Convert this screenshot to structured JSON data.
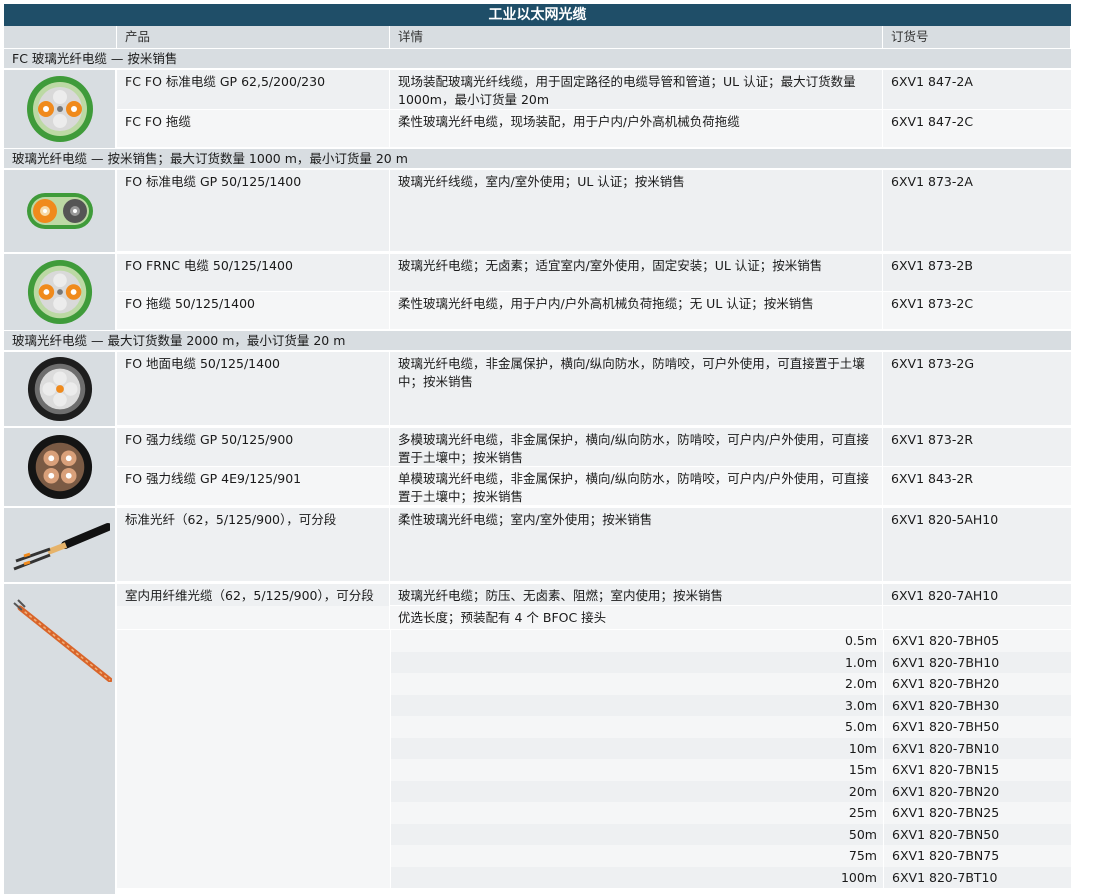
{
  "title": "工业以太网光缆",
  "headers": {
    "product": "产品",
    "details": "详情",
    "order": "订货号"
  },
  "sections": [
    {
      "label": "FC 玻璃光纤电缆 — 按米销售"
    },
    {
      "label": "玻璃光纤电缆 — 按米销售；最大订货数量 1000 m，最小订货量 20 m"
    },
    {
      "label": "玻璃光纤电缆 — 最大订货数量 2000 m，最小订货量 20 m"
    }
  ],
  "rows": [
    {
      "product": "FC FO 标准电缆 GP 62,5/200/230",
      "details": "现场装配玻璃光纤线缆，用于固定路径的电缆导管和管道；UL 认证；最大订货数量 1000m，最小订货量 20m",
      "order": "6XV1 847-2A"
    },
    {
      "product": "FC FO 拖缆",
      "details": "柔性玻璃光纤电缆，现场装配，用于户内/户外高机械负荷拖缆",
      "order": "6XV1 847-2C"
    },
    {
      "product": "FO 标准电缆 GP 50/125/1400",
      "details": "玻璃光纤线缆，室内/室外使用；UL 认证；按米销售",
      "order": "6XV1 873-2A"
    },
    {
      "product": "FO FRNC 电缆 50/125/1400",
      "details": "玻璃光纤电缆；无卤素；适宜室内/室外使用，固定安装；UL 认证；按米销售",
      "order": "6XV1 873-2B"
    },
    {
      "product": "FO 拖缆 50/125/1400",
      "details": "柔性玻璃光纤电缆，用于户内/户外高机械负荷拖缆；无 UL 认证；按米销售",
      "order": "6XV1 873-2C"
    },
    {
      "product": "FO 地面电缆 50/125/1400",
      "details": "玻璃光纤电缆，非金属保护，横向/纵向防水，防啃咬，可户外使用，可直接置于土壤中；按米销售",
      "order": "6XV1 873-2G"
    },
    {
      "product": "FO 强力线缆 GP 50/125/900",
      "details": "多模玻璃光纤电缆，非金属保护，横向/纵向防水，防啃咬，可户内/户外使用，可直接置于土壤中；按米销售",
      "order": "6XV1 873-2R"
    },
    {
      "product": "FO 强力线缆 GP 4E9/125/901",
      "details": "单模玻璃光纤电缆，非金属保护，横向/纵向防水，防啃咬，可户内/户外使用，可直接置于土壤中；按米销售",
      "order": "6XV1 843-2R"
    },
    {
      "product": "标准光纤（62，5/125/900），可分段",
      "details": "柔性玻璃光纤电缆；室内/室外使用；按米销售",
      "order": "6XV1 820-5AH10"
    },
    {
      "product": "室内用纤维光缆（62，5/125/900），可分段",
      "details": "玻璃光纤电缆；防压、无卤素、阻燃；室内使用；按米销售",
      "order": "6XV1 820-7AH10"
    }
  ],
  "preferred": {
    "details": "优选长度；预装配有 4 个 BFOC 接头"
  },
  "lengths": [
    {
      "len": "0.5m",
      "order": "6XV1 820-7BH05"
    },
    {
      "len": "1.0m",
      "order": "6XV1 820-7BH10"
    },
    {
      "len": "2.0m",
      "order": "6XV1 820-7BH20"
    },
    {
      "len": "3.0m",
      "order": "6XV1 820-7BH30"
    },
    {
      "len": "5.0m",
      "order": "6XV1 820-7BH50"
    },
    {
      "len": "10m",
      "order": "6XV1 820-7BN10"
    },
    {
      "len": "15m",
      "order": "6XV1 820-7BN15"
    },
    {
      "len": "20m",
      "order": "6XV1 820-7BN20"
    },
    {
      "len": "25m",
      "order": "6XV1 820-7BN25"
    },
    {
      "len": "50m",
      "order": "6XV1 820-7BN50"
    },
    {
      "len": "75m",
      "order": "6XV1 820-7BN75"
    },
    {
      "len": "100m",
      "order": "6XV1 820-7BT10"
    }
  ]
}
